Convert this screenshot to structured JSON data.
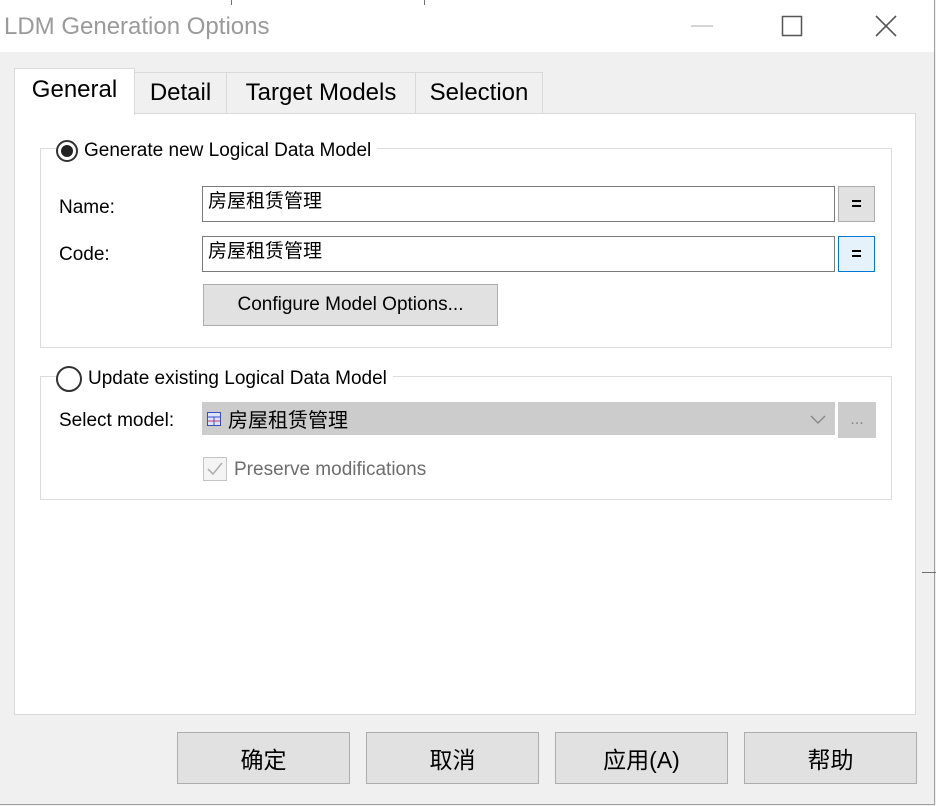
{
  "window": {
    "title": "LDM Generation Options"
  },
  "tabs": [
    {
      "label": "General",
      "active": true
    },
    {
      "label": "Detail",
      "active": false
    },
    {
      "label": "Target Models",
      "active": false
    },
    {
      "label": "Selection",
      "active": false
    }
  ],
  "generate_group": {
    "radio_label": "Generate new Logical Data Model",
    "selected": true,
    "name_label": "Name:",
    "name_value": "房屋租赁管理",
    "code_label": "Code:",
    "code_value": "房屋租赁管理",
    "equal_label": "=",
    "configure_label": "Configure Model Options..."
  },
  "update_group": {
    "radio_label": "Update existing Logical Data Model",
    "selected": false,
    "select_label": "Select model:",
    "select_value": "房屋租赁管理",
    "browse_label": "...",
    "preserve_label": "Preserve modifications",
    "preserve_checked": true
  },
  "footer": {
    "ok": "确定",
    "cancel": "取消",
    "apply": "应用(A)",
    "help": "帮助"
  },
  "colors": {
    "accent_border": "#0078d7",
    "focus_fill": "#e5f1fb",
    "disabled_text": "#6d6d6d"
  }
}
